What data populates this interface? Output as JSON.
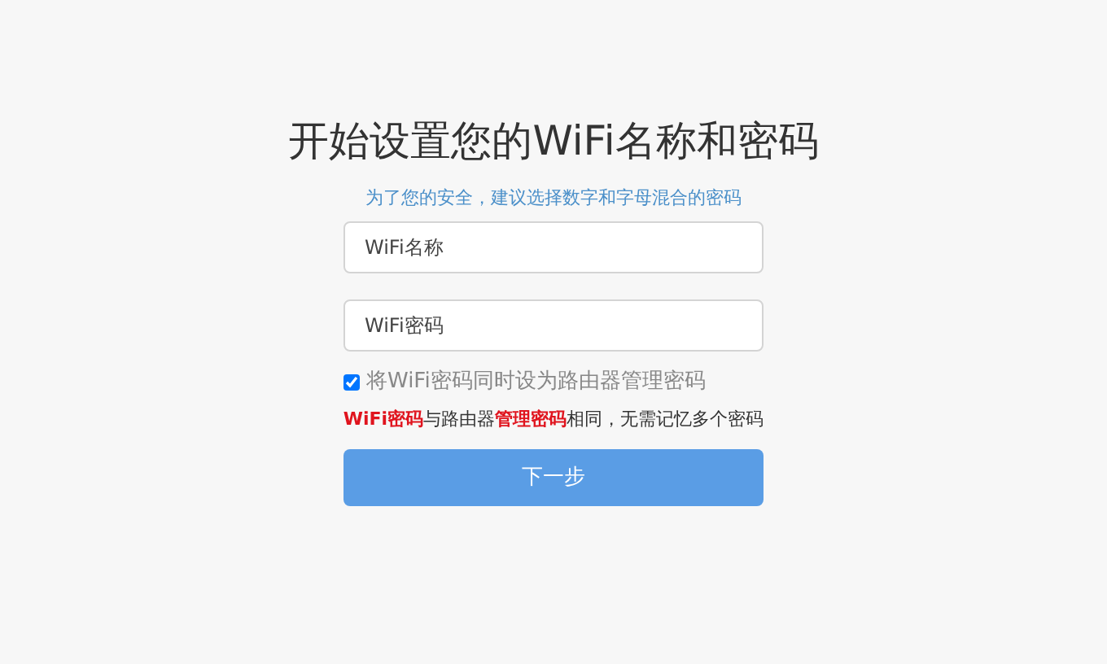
{
  "title": "开始设置您的WiFi名称和密码",
  "subtitle": "为了您的安全，建议选择数字和字母混合的密码",
  "fields": [
    {
      "placeholder": "WiFi名称"
    },
    {
      "placeholder": "WiFi密码"
    }
  ],
  "sync_option": {
    "label": "将WiFi密码同时设为路由器管理密码",
    "checked": true
  },
  "note": "**WiFi密码**与路由器**管理密码**相同，无需记忆多个密码",
  "next_button": "下一步"
}
